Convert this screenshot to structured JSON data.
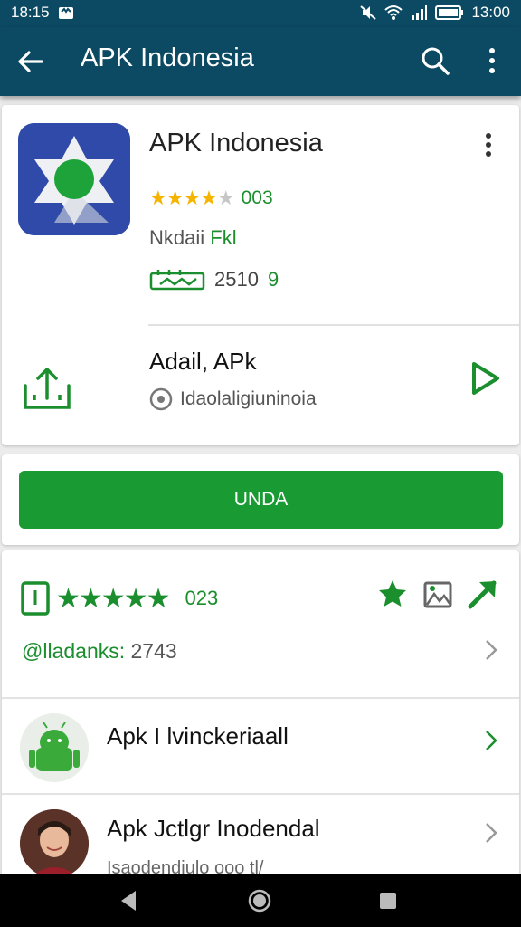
{
  "status_bar": {
    "time_left": "18:15",
    "time_right": "13:00"
  },
  "app_bar": {
    "title": "APK Indonesia"
  },
  "app": {
    "name": "APK Indonesia",
    "rating_stars": 4,
    "rating_count": "003",
    "developer_prefix": "Nkdaii",
    "developer_suffix": "Fkl",
    "size_number": "2510",
    "size_suffix": "9",
    "sub_title": "Adail, APk",
    "sub_url": "Idaolaligiuninoia"
  },
  "install_button": {
    "label": "UNDA"
  },
  "reviews": {
    "stars": 5,
    "count": "023",
    "rank_label": "@lladanks:",
    "rank_value": "2743"
  },
  "list_items": [
    {
      "label": "Apk I lvinckeriaall"
    },
    {
      "label": "Apk Jctlgr Inodendal",
      "subtext": "Isaodendiulo ooo tl/"
    }
  ],
  "colors": {
    "primary": "#0c4a63",
    "accent_green": "#199a32",
    "star_yellow": "#f5b400",
    "icon_blue": "#2f4aa8"
  }
}
